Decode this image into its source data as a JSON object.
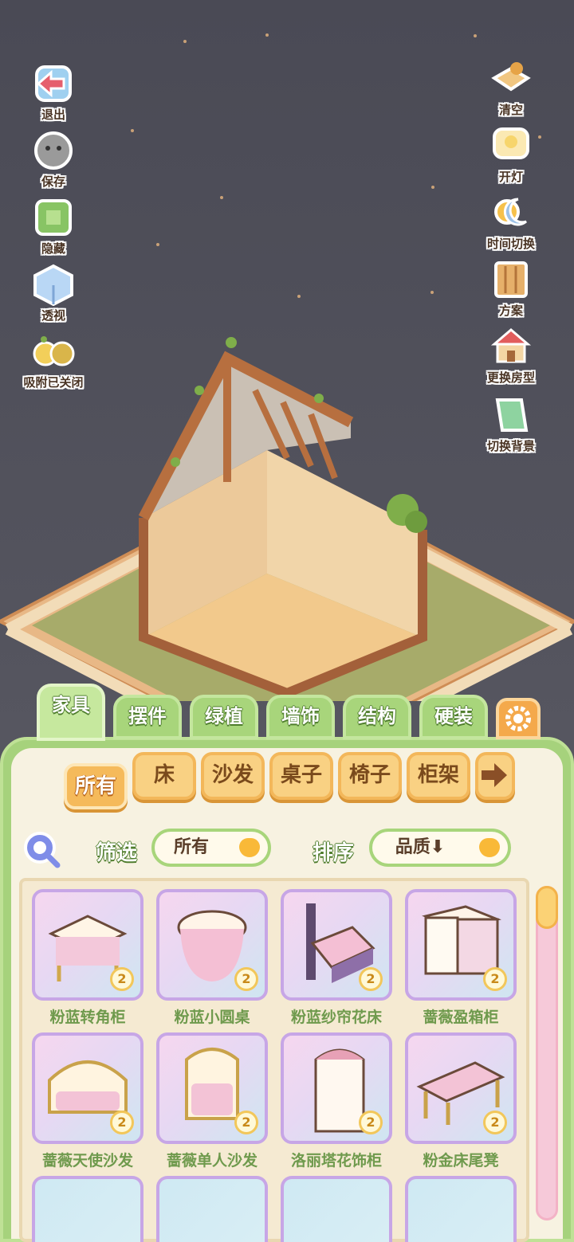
{
  "left_buttons": [
    {
      "label": "退出",
      "icon": "exit-icon"
    },
    {
      "label": "保存",
      "icon": "save-icon"
    },
    {
      "label": "隐藏",
      "icon": "hide-icon"
    },
    {
      "label": "透视",
      "icon": "perspective-icon"
    },
    {
      "label": "吸附已关闭",
      "icon": "snap-off-icon"
    }
  ],
  "right_buttons": [
    {
      "label": "清空",
      "icon": "clear-icon"
    },
    {
      "label": "开灯",
      "icon": "light-icon"
    },
    {
      "label": "时间切换",
      "icon": "time-switch-icon"
    },
    {
      "label": "方案",
      "icon": "plan-icon"
    },
    {
      "label": "更换房型",
      "icon": "house-type-icon"
    },
    {
      "label": "切换背景",
      "icon": "background-icon"
    }
  ],
  "tabs": [
    "家具",
    "摆件",
    "绿植",
    "墙饰",
    "结构",
    "硬装"
  ],
  "active_tab": "家具",
  "categories": [
    "所有",
    "床",
    "沙发",
    "桌子",
    "椅子",
    "柜架"
  ],
  "filter": {
    "label": "筛选",
    "value": "所有"
  },
  "sort": {
    "label": "排序",
    "value": "品质⬇"
  },
  "items": [
    {
      "name": "粉蓝转角柜",
      "count": "2"
    },
    {
      "name": "粉蓝小圆桌",
      "count": "2"
    },
    {
      "name": "粉蓝纱帘花床",
      "count": "2"
    },
    {
      "name": "蔷薇盈箱柜",
      "count": "2"
    },
    {
      "name": "蔷薇天使沙发",
      "count": "2"
    },
    {
      "name": "蔷薇单人沙发",
      "count": "2"
    },
    {
      "name": "洛丽塔花饰柜",
      "count": "2"
    },
    {
      "name": "粉金床尾凳",
      "count": "2"
    }
  ],
  "colors": {
    "panel_green": "#a6d27c",
    "tab_orange": "#f5ba5b",
    "accent_brown": "#8a4f27"
  }
}
